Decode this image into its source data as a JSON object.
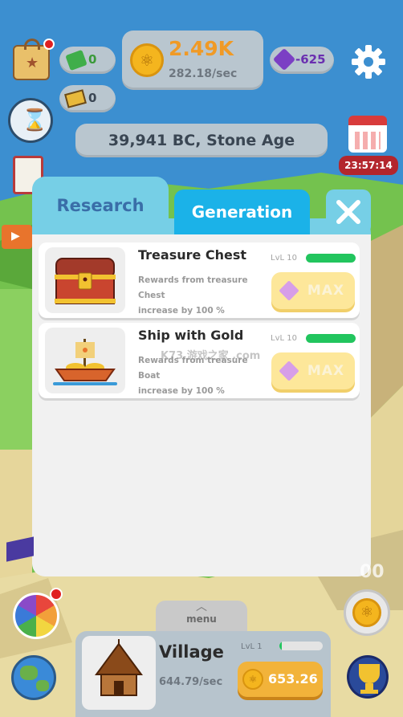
{
  "hud": {
    "cash_count": "0",
    "ticket_count": "0",
    "coins_total": "2.49K",
    "coins_rate": "282.18/sec",
    "gems": "-625",
    "era": "39,941 BC, Stone Age",
    "timer": "23:57:14"
  },
  "modal": {
    "tabs": [
      {
        "label": "Research"
      },
      {
        "label": "Generation"
      }
    ],
    "cards": [
      {
        "title": "Treasure Chest",
        "desc_line1": "Rewards from treasure",
        "desc_line2": "Chest",
        "desc_line3": "increase by 100 %",
        "level": "LvL 10",
        "progress": 1.0,
        "button": "MAX"
      },
      {
        "title": "Ship with Gold",
        "desc_line1": "Rewards from treasure",
        "desc_line2": "Boat",
        "desc_line3": "increase by 100 %",
        "level": "LvL 10",
        "progress": 1.0,
        "button": "MAX"
      }
    ]
  },
  "watermark": "K73 游戏之家 .com",
  "bottom": {
    "menu_label": "menu",
    "building_name": "Village",
    "building_rate": "644.79/sec",
    "building_level": "LvL 1",
    "building_progress": 0.05,
    "upgrade_cost": "653.26",
    "partial_number": "00"
  },
  "colors": {
    "tab_active": "#76cfe6",
    "tab_inactive": "#1bb2e8",
    "progress": "#22c55e",
    "max_button": "#fde79a",
    "gem": "#7b3fc4",
    "timer_bg": "#b3262d"
  }
}
